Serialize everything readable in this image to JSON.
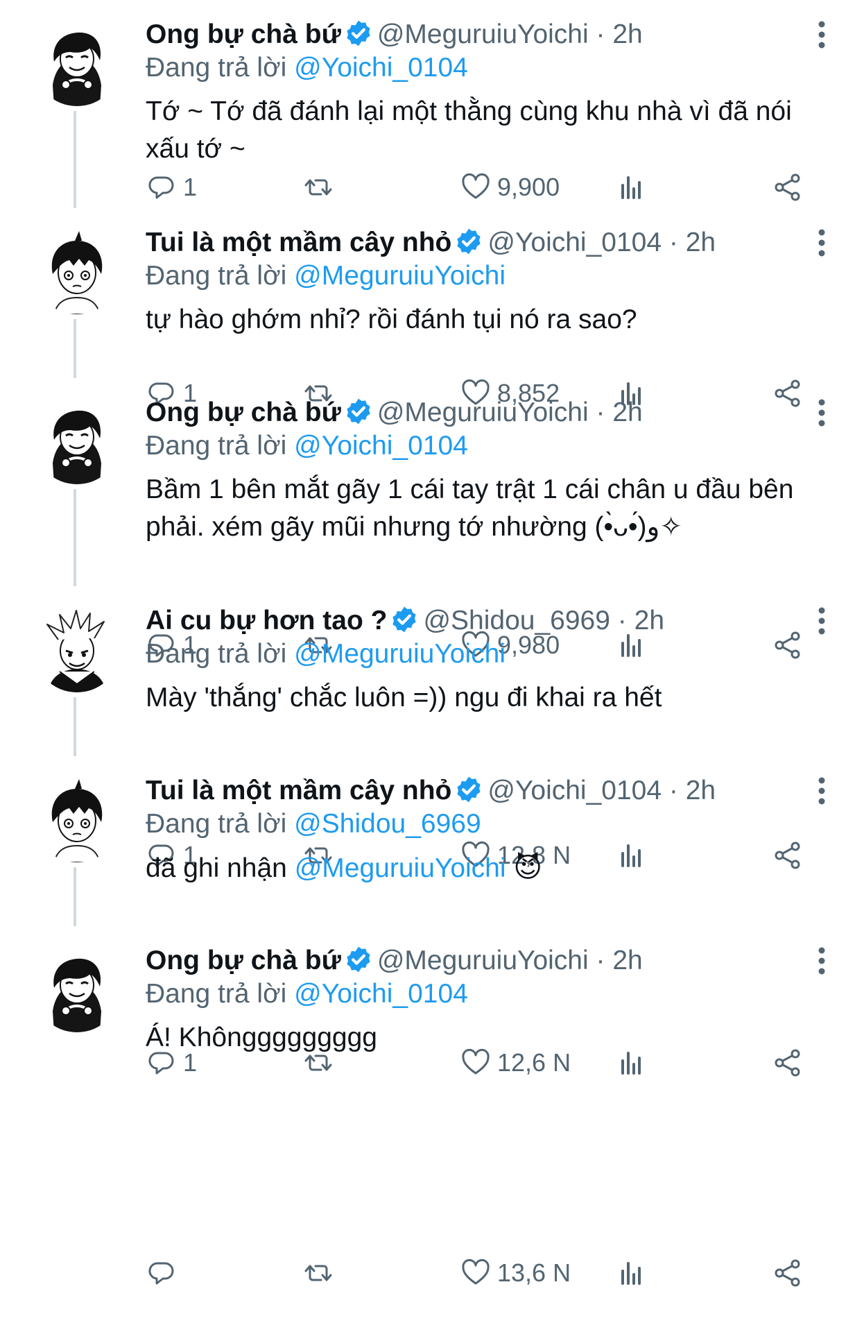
{
  "accent": "#1d9bf0",
  "reply_prefix": "Đang trả lời",
  "dot": "·",
  "tweets": [
    {
      "name": "Ong bự chà bứ",
      "verified": true,
      "handle": "@MeguruiuYoichi",
      "time": "2h",
      "reply_to": "@Yoichi_0104",
      "text": "Tớ ~ Tớ đã đánh lại một thằng cùng khu nhà vì đã nói xấu tớ ~",
      "text_mention": "",
      "text_emoji": "",
      "replies": "1",
      "retweets": "",
      "likes": "9,900",
      "avatar": "bachira-avatar"
    },
    {
      "name": "Tui là một mầm cây nhỏ",
      "verified": true,
      "handle": "@Yoichi_0104",
      "time": "2h",
      "reply_to": "@MeguruiuYoichi",
      "text": "tự hào ghớm nhỉ? rồi đánh tụi nó ra sao?",
      "text_mention": "",
      "text_emoji": "",
      "replies": "1",
      "retweets": "",
      "likes": "8,852",
      "avatar": "isagi-avatar"
    },
    {
      "name": "Ong bự chà bứ",
      "verified": true,
      "handle": "@MeguruiuYoichi",
      "time": "2h",
      "reply_to": "@Yoichi_0104",
      "text": "Bầm 1 bên mắt gãy 1 cái tay trật 1 cái chân u đầu bên phải. xém gãy mũi nhưng tớ nhường (•̀ᴗ•́)و✧",
      "text_mention": "",
      "text_emoji": "",
      "replies": "1",
      "retweets": "",
      "likes": "9,980",
      "avatar": "bachira-avatar"
    },
    {
      "name": "Ai cu bự hơn tao ?",
      "verified": true,
      "handle": "@Shidou_6969",
      "time": "2h",
      "reply_to": "@MeguruiuYoichi",
      "text": "Mày 'thắng' chắc luôn =)) ngu đi khai ra hết",
      "text_mention": "",
      "text_emoji": "",
      "replies": "1",
      "retweets": "",
      "likes": "12,8 N",
      "avatar": "shidou-avatar"
    },
    {
      "name": "Tui là một mầm cây nhỏ",
      "verified": true,
      "handle": "@Yoichi_0104",
      "time": "2h",
      "reply_to": "@Shidou_6969",
      "text": "đã ghi nhận ",
      "text_mention": "@MeguruiuYoichi",
      "text_emoji": "😈",
      "replies": "1",
      "retweets": "",
      "likes": "12,6 N",
      "avatar": "isagi-avatar"
    },
    {
      "name": "Ong bự chà bứ",
      "verified": true,
      "handle": "@MeguruiuYoichi",
      "time": "2h",
      "reply_to": "@Yoichi_0104",
      "text": "Á! Khônggggggggg",
      "text_mention": "",
      "text_emoji": "",
      "replies": "",
      "retweets": "",
      "likes": "13,6 N",
      "avatar": "bachira-avatar"
    }
  ],
  "icons": {
    "reply": "speech-bubble-icon",
    "retweet": "retweet-arrows-icon",
    "like": "heart-outline-icon",
    "views": "bar-chart-icon",
    "share": "share-nodes-icon",
    "verified": "verified-badge-icon",
    "more": "vertical-dots-icon"
  }
}
